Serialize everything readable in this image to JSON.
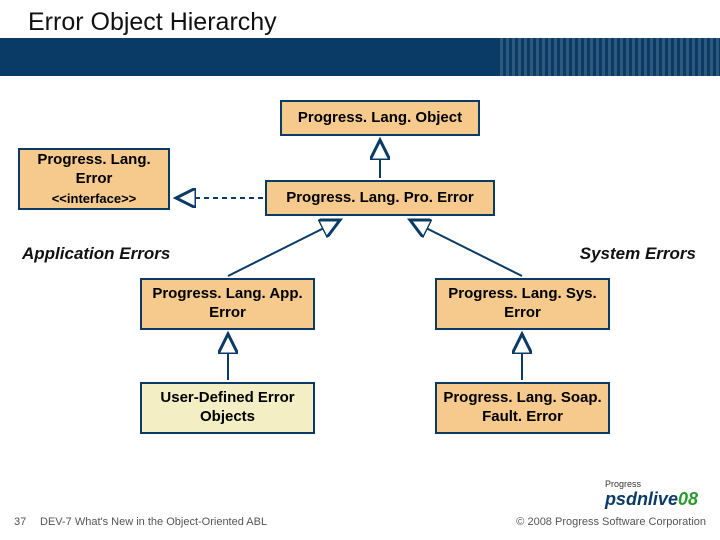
{
  "title": "Error Object Hierarchy",
  "boxes": {
    "object": "Progress. Lang. Object",
    "error": "Progress. Lang. Error",
    "error_sub": "<<interface>>",
    "proerror": "Progress. Lang. Pro. Error",
    "apperror": "Progress. Lang. App. Error",
    "syserror": "Progress. Lang. Sys. Error",
    "userdef": "User-Defined Error Objects",
    "soapfault": "Progress. Lang. Soap. Fault. Error"
  },
  "labels": {
    "app": "Application Errors",
    "sys": "System Errors"
  },
  "footer": {
    "slidenum": "37",
    "subtitle": "DEV-7 What's New in the Object-Oriented ABL",
    "copyright": "© 2008 Progress Software Corporation",
    "logo_small": "Progress",
    "logo_main": "psdnlive",
    "logo_year": "08"
  },
  "colors": {
    "navy": "#0a3b66",
    "tan": "#f6c98c",
    "beige": "#f3eec3"
  }
}
